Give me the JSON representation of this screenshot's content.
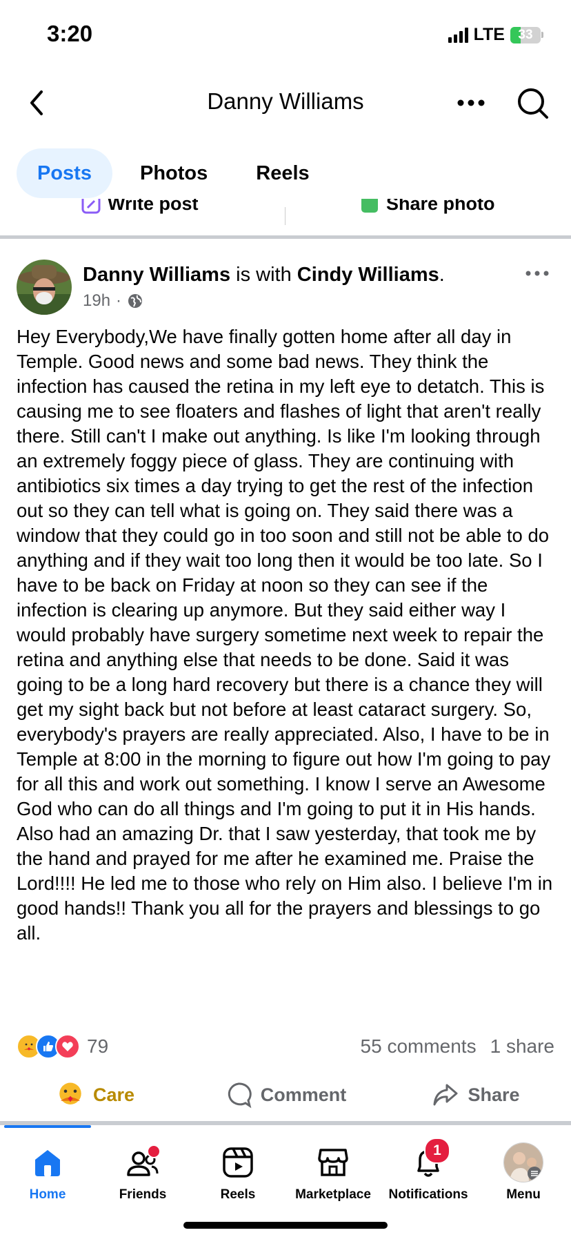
{
  "status_bar": {
    "time": "3:20",
    "network": "LTE",
    "battery": "33",
    "battery_level": 0.33
  },
  "header": {
    "title": "Danny Williams"
  },
  "tabs": [
    {
      "label": "Posts",
      "active": true
    },
    {
      "label": "Photos",
      "active": false
    },
    {
      "label": "Reels",
      "active": false
    }
  ],
  "composer": {
    "write_post": "Write post",
    "share_photo": "Share photo"
  },
  "post": {
    "author": "Danny Williams",
    "with_text": " is with ",
    "tagged": "Cindy Williams",
    "period": ".",
    "time": "19h",
    "dot": "·",
    "body": "Hey Everybody,We have finally gotten home after all day in Temple. Good news and some bad news. They think the infection has caused the retina in my left eye to detatch. This is causing me to see floaters and flashes of light that aren't really there. Still can't I make out anything. Is like I'm looking through an extremely foggy piece of glass. They are continuing with antibiotics six times a day trying to get the rest of the infection out so they can tell what is going on. They said there was a window that they could go in too soon and still not be able to do anything and if they wait too long then it would be too late. So I have to be back on Friday at noon so they can see if the infection is clearing up anymore. But they said either way I would probably have surgery sometime next week to repair the retina and anything else that needs to be done. Said it was going to be a long hard recovery but there is a chance they will get my sight back but not before at least cataract surgery. So, everybody's prayers are really appreciated. Also, I have to be in Temple at 8:00 in the morning to figure out how I'm going to pay for all this and work out something. I know I serve an Awesome God who can do all things and I'm going to put it in His hands. Also had an amazing Dr. that I saw yesterday, that took me by the hand and prayed for me after he examined me. Praise the Lord!!!! He led me to those who rely on Him also. I believe I'm in good hands!! Thank you all for the prayers and blessings to go all.",
    "reaction_count": "79",
    "comments": "55 comments",
    "shares": "1 share"
  },
  "actions": {
    "care": "Care",
    "comment": "Comment",
    "share": "Share"
  },
  "bottom_nav": [
    {
      "label": "Home",
      "icon": "home-icon",
      "active": true
    },
    {
      "label": "Friends",
      "icon": "friends-icon",
      "dot": true
    },
    {
      "label": "Reels",
      "icon": "reels-icon"
    },
    {
      "label": "Marketplace",
      "icon": "marketplace-icon"
    },
    {
      "label": "Notifications",
      "icon": "bell-icon",
      "badge": "1"
    },
    {
      "label": "Menu",
      "icon": "menu-avatar"
    }
  ],
  "colors": {
    "accent": "#1877f2",
    "care": "#b88a00",
    "badge": "#e41e3f",
    "muted": "#65676b"
  }
}
